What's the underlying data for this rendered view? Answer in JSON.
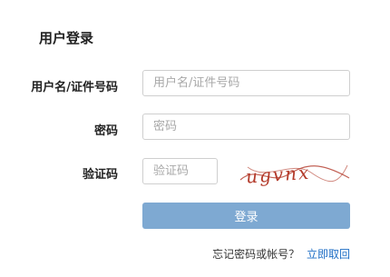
{
  "login": {
    "title": "用户登录",
    "username_label": "用户名/证件号码",
    "username_placeholder": "用户名/证件号码",
    "password_label": "密码",
    "password_placeholder": "密码",
    "captcha_label": "验证码",
    "captcha_placeholder": "验证码",
    "captcha_text": "ugvnx",
    "submit_label": "登录",
    "forgot_text": "忘记密码或帐号？",
    "recover_link": "立即取回"
  },
  "colors": {
    "button": "#7ea9d2",
    "link": "#1f6fc6",
    "captcha": "#b33a2a"
  }
}
